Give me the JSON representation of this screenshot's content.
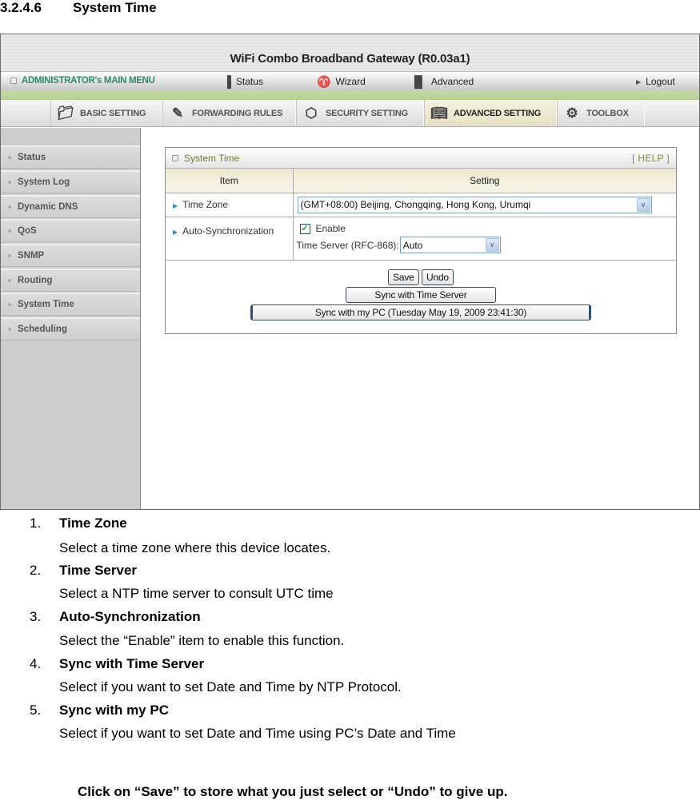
{
  "doc": {
    "section_number": "3.2.4.6",
    "section_title": "System Time",
    "list": [
      {
        "num": "1.",
        "title": "Time Zone",
        "desc": "Select a time zone where this device locates."
      },
      {
        "num": "2.",
        "title": "Time Server",
        "desc": "Select a NTP time server to consult UTC time"
      },
      {
        "num": "3.",
        "title": "Auto-Synchronization",
        "desc": "Select the “Enable” item to enable this function."
      },
      {
        "num": "4.",
        "title": "Sync with Time Server",
        "desc": "Select if you want to set Date and Time by NTP Protocol."
      },
      {
        "num": "5.",
        "title": "Sync with my PC",
        "desc": "Select if you want to set Date and Time using PC’s Date and Time"
      }
    ],
    "footer_note": "Click on “Save” to store what you just select or “Undo” to give up."
  },
  "router_ui": {
    "banner_title": "WiFi Combo Broadband Gateway (R0.03a1)",
    "menubar": {
      "admin_label": "ADMINISTRATOR's MAIN MENU",
      "status": "Status",
      "wizard": "Wizard",
      "advanced": "Advanced",
      "logout": "Logout"
    },
    "tabs": [
      {
        "label": "BASIC SETTING",
        "icon": "folder-icon"
      },
      {
        "label": "FORWARDING RULES",
        "icon": "forwarding-icon"
      },
      {
        "label": "SECURITY SETTING",
        "icon": "security-icon"
      },
      {
        "label": "ADVANCED SETTING",
        "icon": "advanced-icon",
        "active": true
      },
      {
        "label": "TOOLBOX",
        "icon": "toolbox-icon"
      }
    ],
    "sidebar": [
      "Status",
      "System Log",
      "Dynamic DNS",
      "QoS",
      "SNMP",
      "Routing",
      "System Time",
      "Scheduling"
    ],
    "panel": {
      "title": "System Time",
      "help": "[ HELP ]",
      "col_item": "Item",
      "col_setting": "Setting",
      "time_zone_label": "Time Zone",
      "time_zone_value": "(GMT+08:00) Beijing, Chongqing, Hong Kong, Urumqi",
      "auto_sync_label": "Auto-Synchronization",
      "enable_label": "Enable",
      "enable_checked": true,
      "time_server_label": "Time Server (RFC-868):",
      "time_server_value": "Auto",
      "save_label": "Save",
      "undo_label": "Undo",
      "sync_server_label": "Sync with Time Server",
      "sync_pc_label": "Sync with my PC (Tuesday May 19, 2009 23:41:30)"
    }
  }
}
